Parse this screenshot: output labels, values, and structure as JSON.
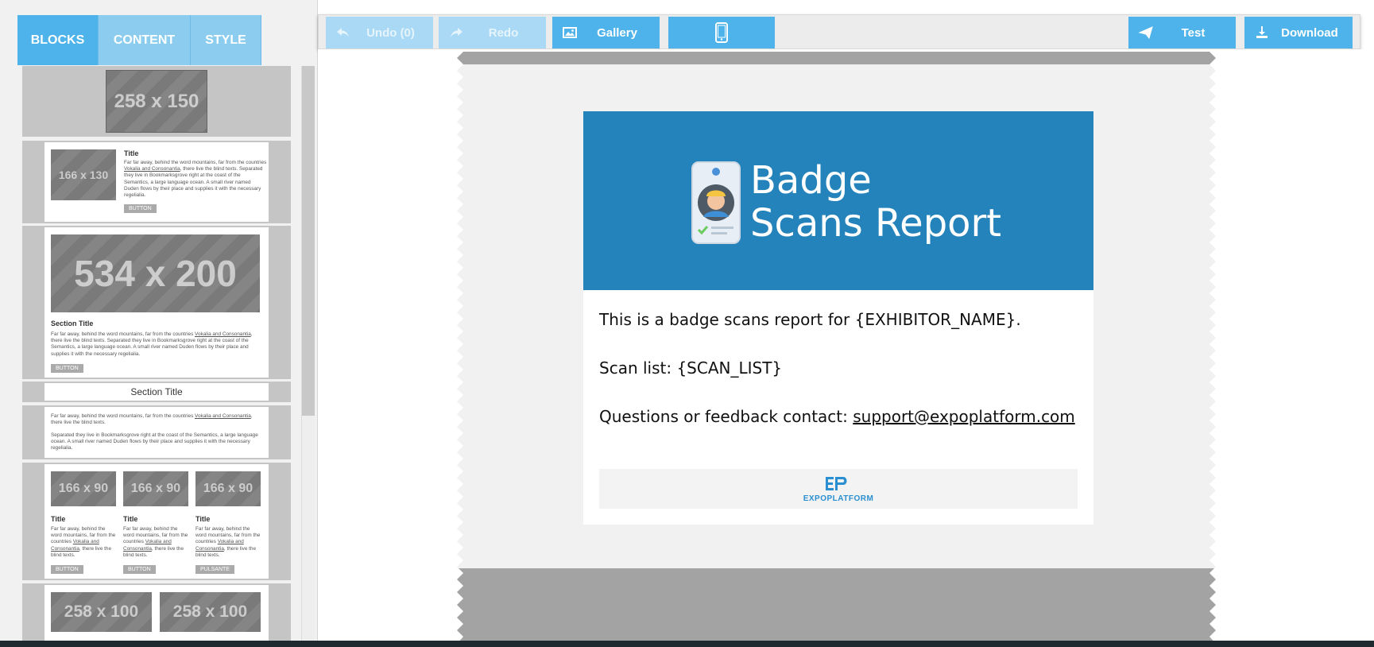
{
  "tabs": [
    {
      "label": "BLOCKS",
      "active": true
    },
    {
      "label": "CONTENT",
      "active": false
    },
    {
      "label": "STYLE",
      "active": false
    }
  ],
  "blocks": {
    "ph_258x150": "258 x 150",
    "ph_166x130": "166 x 130",
    "ph_534x200": "534 x 200",
    "ph_166x90": "166 x 90",
    "ph_258x100": "258 x 100",
    "title": "Title",
    "section_title": "Section Title",
    "button": "BUTTON",
    "pulsante": "PULSANTE",
    "text_a1": "Far far away, behind the word mountains, far from the countries",
    "text_link": "Vokalia and Consonantia",
    "text_a2": ", there live the blind texts. Separated they live in Bookmarksgrove right at the coast of the Semantics, a large language ocean. A small river named Duden flows by their place and supplies it with the necessary regelialia.",
    "text_b1": "Far far away, behind the word mountains, far from the countries",
    "text_b2": ", there live the blind texts.",
    "text_b3": "Separated they live in Bookmarksgrove right at the coast of the Semantics, a large language ocean. A small river named Duden flows by their place and supplies it with the necessary regelialia.",
    "text_c1": "Far far away, behind the word mountains, far from the countries",
    "text_c2": ", there live the blind texts."
  },
  "toolbar": {
    "undo": "Undo (0)",
    "redo": "Redo",
    "gallery": "Gallery",
    "test": "Test",
    "download": "Download"
  },
  "email": {
    "hero_line1": "Badge",
    "hero_line2": "Scans Report",
    "line1": "This is a badge scans report for {EXHIBITOR_NAME}.",
    "line2": "Scan list: {SCAN_LIST}",
    "line3_prefix": "Questions or feedback contact: ",
    "line3_link": "support@expoplatform.com",
    "footer_logo_text": "EXPOPLATFORM",
    "footer_logo_mark": "EP"
  },
  "colors": {
    "accent": "#4db3ea",
    "hero": "#2583bb"
  }
}
